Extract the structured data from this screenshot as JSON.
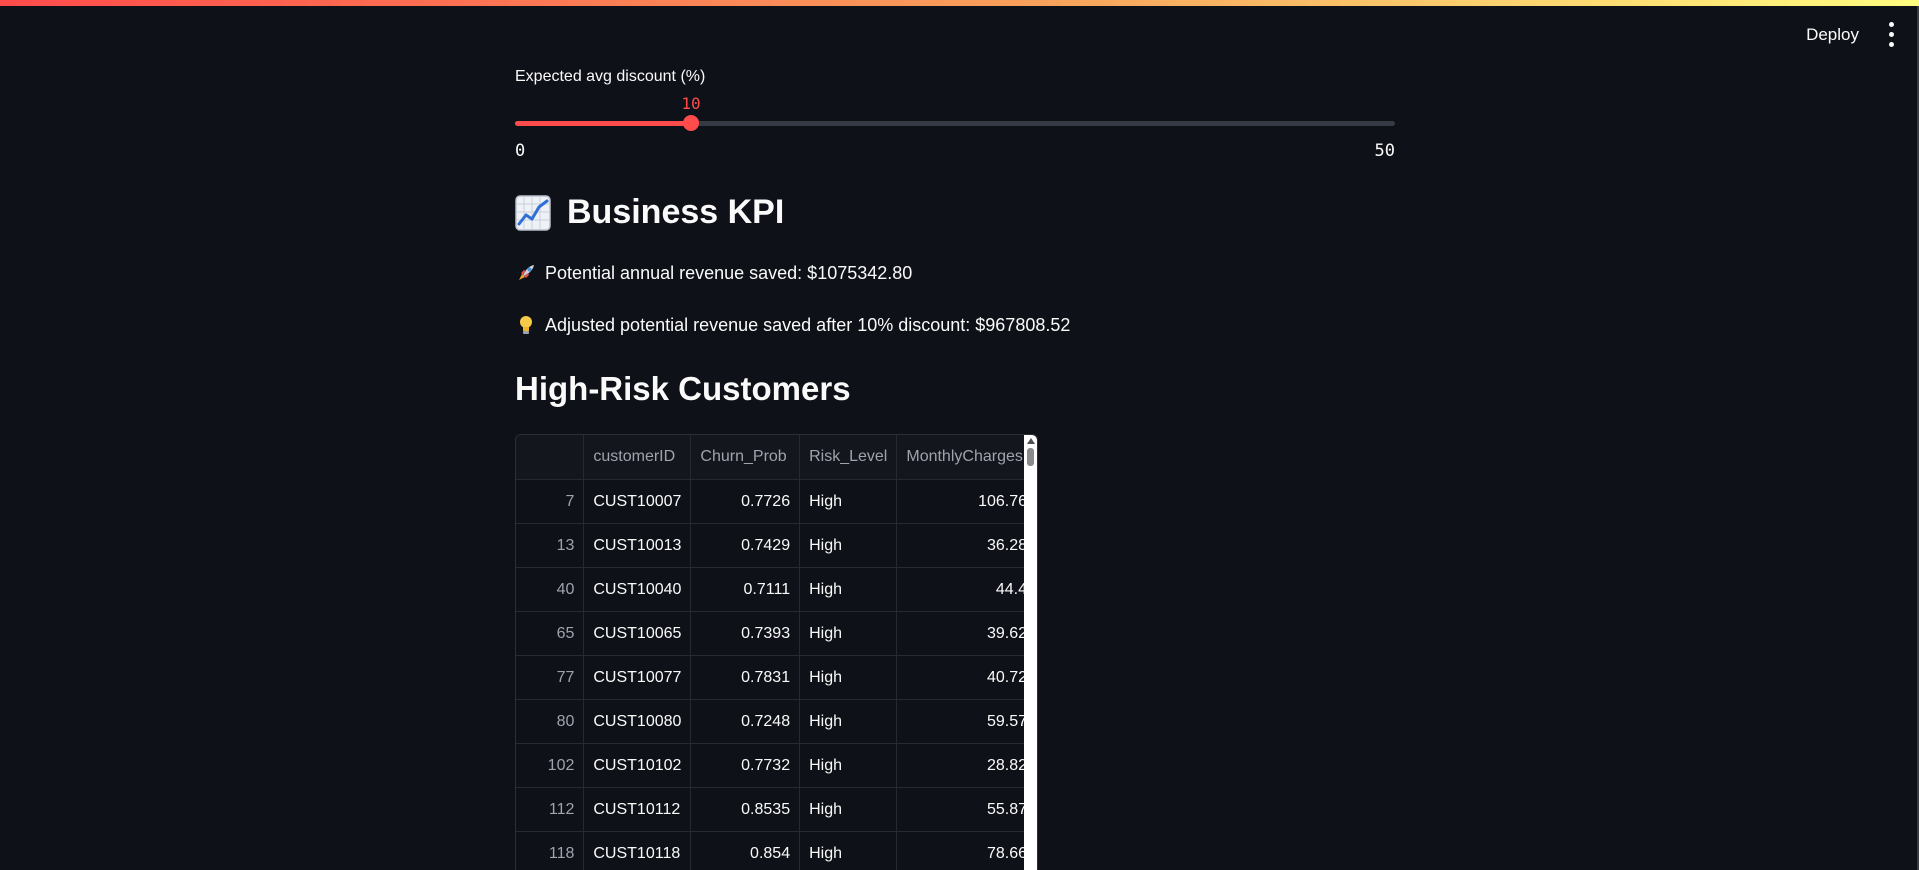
{
  "toolbar": {
    "deploy_label": "Deploy",
    "menu_icon": "kebab-menu-icon"
  },
  "slider": {
    "label": "Expected avg discount (%)",
    "value": "10",
    "min": "0",
    "max": "50",
    "fraction": 0.2,
    "accent": "#ff4b4b"
  },
  "kpi": {
    "title_icon": "chart-increasing-icon",
    "title": "Business KPI",
    "revenue_icon": "rocket-icon",
    "revenue_saved": "Potential annual revenue saved: $1075342.80",
    "adjusted_icon": "light-bulb-icon",
    "adjusted_saved": "Adjusted potential revenue saved after 10% discount: $967808.52"
  },
  "high_risk": {
    "title": "High-Risk Customers",
    "columns": [
      "",
      "customerID",
      "Churn_Prob",
      "Risk_Level",
      "MonthlyCharges"
    ],
    "rows": [
      [
        "7",
        "CUST10007",
        "0.7726",
        "High",
        "106.76"
      ],
      [
        "13",
        "CUST10013",
        "0.7429",
        "High",
        "36.28"
      ],
      [
        "40",
        "CUST10040",
        "0.7111",
        "High",
        "44.4"
      ],
      [
        "65",
        "CUST10065",
        "0.7393",
        "High",
        "39.62"
      ],
      [
        "77",
        "CUST10077",
        "0.7831",
        "High",
        "40.72"
      ],
      [
        "80",
        "CUST10080",
        "0.7248",
        "High",
        "59.57"
      ],
      [
        "102",
        "CUST10102",
        "0.7732",
        "High",
        "28.82"
      ],
      [
        "112",
        "CUST10112",
        "0.8535",
        "High",
        "55.87"
      ],
      [
        "118",
        "CUST10118",
        "0.854",
        "High",
        "78.66"
      ]
    ]
  },
  "colors": {
    "background": "#0e1117",
    "accent": "#ff4b4b",
    "text": "#fafafa"
  }
}
